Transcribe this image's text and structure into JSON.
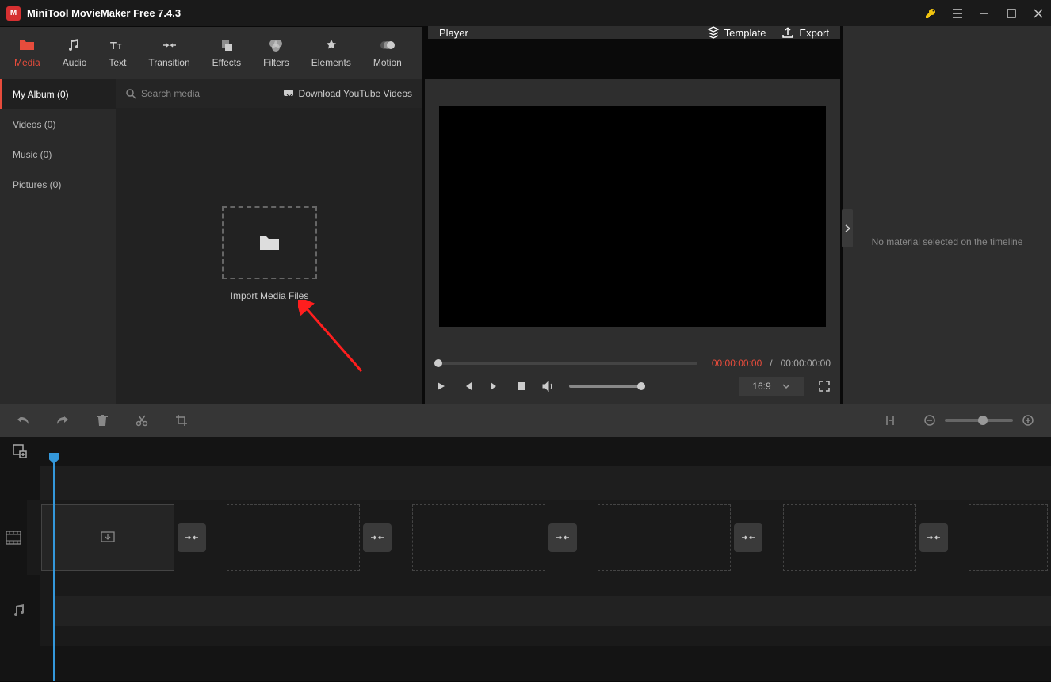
{
  "app": {
    "title": "MiniTool MovieMaker Free 7.4.3"
  },
  "ribbon": {
    "tabs": [
      {
        "label": "Media",
        "icon": "folder"
      },
      {
        "label": "Audio",
        "icon": "music-note"
      },
      {
        "label": "Text",
        "icon": "text"
      },
      {
        "label": "Transition",
        "icon": "transition"
      },
      {
        "label": "Effects",
        "icon": "sparkle"
      },
      {
        "label": "Filters",
        "icon": "circles"
      },
      {
        "label": "Elements",
        "icon": "star"
      },
      {
        "label": "Motion",
        "icon": "motion"
      }
    ],
    "active_index": 0
  },
  "player_header": {
    "title": "Player",
    "template_label": "Template",
    "export_label": "Export"
  },
  "sidebar": {
    "items": [
      {
        "label": "My Album (0)"
      },
      {
        "label": "Videos (0)"
      },
      {
        "label": "Music (0)"
      },
      {
        "label": "Pictures (0)"
      }
    ],
    "active_index": 0
  },
  "media_panel": {
    "search_placeholder": "Search media",
    "download_label": "Download YouTube Videos",
    "import_label": "Import Media Files"
  },
  "player": {
    "time_current": "00:00:00:00",
    "time_separator": "/",
    "time_total": "00:00:00:00",
    "aspect_ratio": "16:9"
  },
  "properties": {
    "empty_text": "No material selected on the timeline"
  },
  "colors": {
    "accent": "#e74c3c",
    "playhead": "#3498db",
    "arrow": "#ff1e1e"
  }
}
